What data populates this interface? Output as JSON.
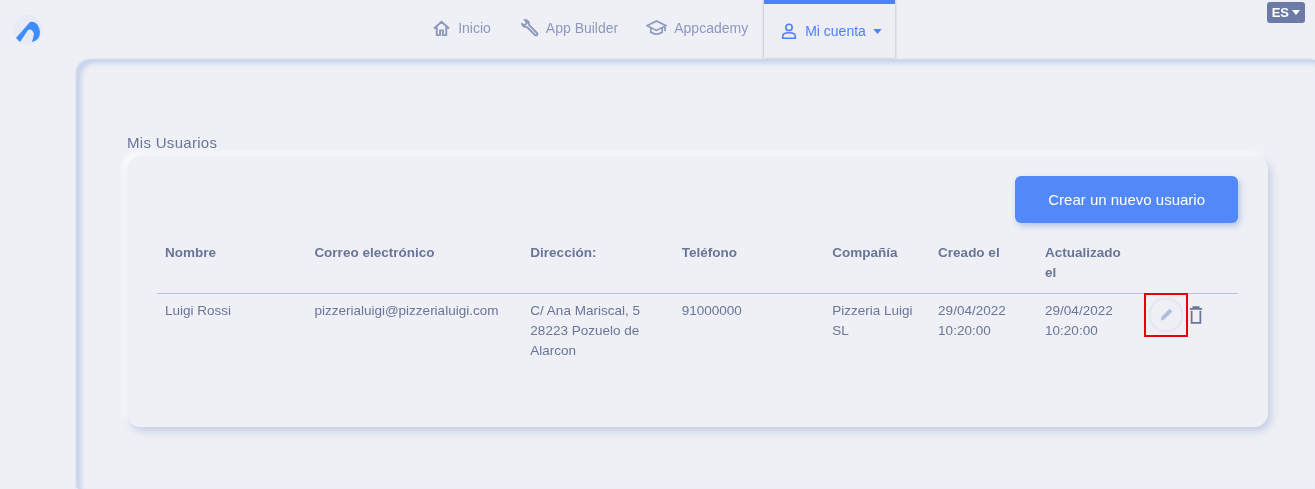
{
  "nav": {
    "tabs": [
      {
        "label": "Inicio",
        "selected": false,
        "dropdown": false
      },
      {
        "label": "App Builder",
        "selected": false,
        "dropdown": false
      },
      {
        "label": "Appcademy",
        "selected": false,
        "dropdown": false
      },
      {
        "label": "Mi cuenta",
        "selected": true,
        "dropdown": true
      }
    ],
    "language": "ES"
  },
  "section_title": "Mis Usuarios",
  "create_button": "Crear un nuevo usuario",
  "table": {
    "columns": [
      "Nombre",
      "Correo electrónico",
      "Dirección:",
      "Teléfono",
      "Compañía",
      "Creado el",
      "Actualizado el"
    ],
    "rows": [
      {
        "cells": [
          "Luigi Rossi",
          "pizzerialuigi@pizzerialuigi.com",
          "C/ Ana Mariscal, 5 28223 Pozuelo de Alarcon",
          "91000000",
          "Pizzeria Luigi SL",
          "29/04/2022 10:20:00",
          "29/04/2022 10:20:00"
        ],
        "edit_highlighted": true
      }
    ]
  }
}
